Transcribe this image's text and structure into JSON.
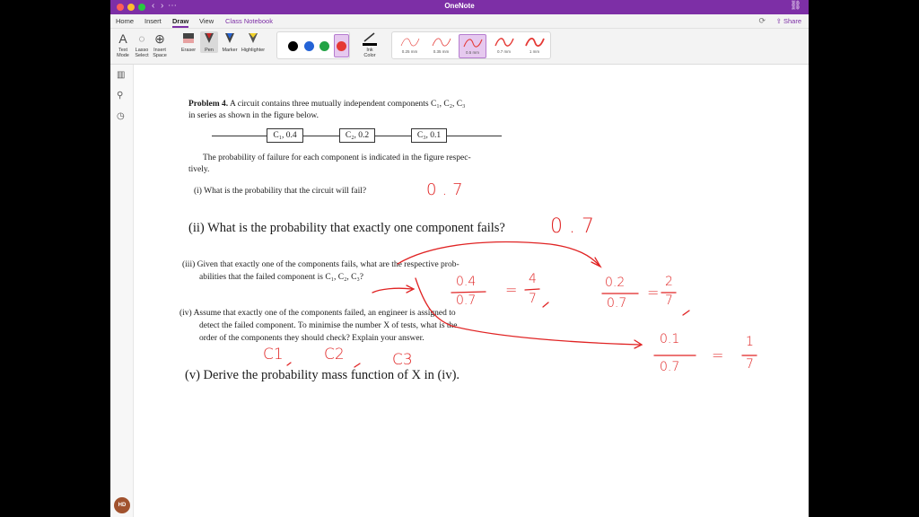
{
  "app": {
    "title": "OneNote",
    "tabs": [
      "Home",
      "Insert",
      "Draw",
      "View",
      "Class Notebook"
    ],
    "active_tab": "Draw",
    "share_label": "Share",
    "avatar_initials": "HD"
  },
  "toolbar": {
    "text_mode": [
      "Text",
      "Mode"
    ],
    "lasso_select": [
      "Lasso",
      "Select"
    ],
    "insert_space": [
      "Insert",
      "Space"
    ],
    "eraser": "Eraser",
    "pen": "Pen",
    "marker": "Marker",
    "highlighter": "Highlighter",
    "ink_color": [
      "Ink",
      "Color"
    ],
    "colors": [
      "#000000",
      "#2463d6",
      "#23a345",
      "#e53935"
    ],
    "selected_color": "#e53935",
    "thicknesses": [
      "0.25 mm",
      "0.35 mm",
      "0.5 mm",
      "0.7 mm",
      "1 mm"
    ],
    "selected_thickness": "0.5 mm"
  },
  "document": {
    "problem_label": "Problem 4.",
    "intro_line1": "A circuit contains three mutually independent components C₁, C₂, C₃",
    "intro_line2": "in series as shown in the figure below.",
    "components": [
      "C₁, 0.4",
      "C₂, 0.2",
      "C₃, 0.1"
    ],
    "prob_line1": "The probability of failure for each component is indicated in the figure respec-",
    "prob_line2": "tively.",
    "q1": "(i) What is the probability that the circuit will fail?",
    "q2": "(ii) What is the probability that exactly one component fails?",
    "q3_line1": "(iii) Given that exactly one of the components fails, what are the respective prob-",
    "q3_line2": "abilities that the failed component is C₁, C₂, C₃?",
    "q4_line1": "(iv) Assume that exactly one of the components failed, an engineer is assigned to",
    "q4_line2": "detect the failed component. To minimise the number X of tests, what is the",
    "q4_line3": "order of the components they should check? Explain your answer.",
    "q5": "(v) Derive the probability mass function of X in (iv)."
  },
  "ink": {
    "ans1": "0.7",
    "ans2": "0.7",
    "frac1_num": "0.4",
    "frac1_den": "0.7",
    "frac1_res_num": "4",
    "frac1_res_den": "7",
    "frac2_num": "0.2",
    "frac2_den": "0.7",
    "frac2_res_num": "2",
    "frac2_res_den": "7",
    "frac3_num": "0.1",
    "frac3_den": "0.7",
    "frac3_res_num": "1",
    "frac3_res_den": "7",
    "equals": "=",
    "order": [
      "C1",
      "C2",
      "C3"
    ]
  }
}
